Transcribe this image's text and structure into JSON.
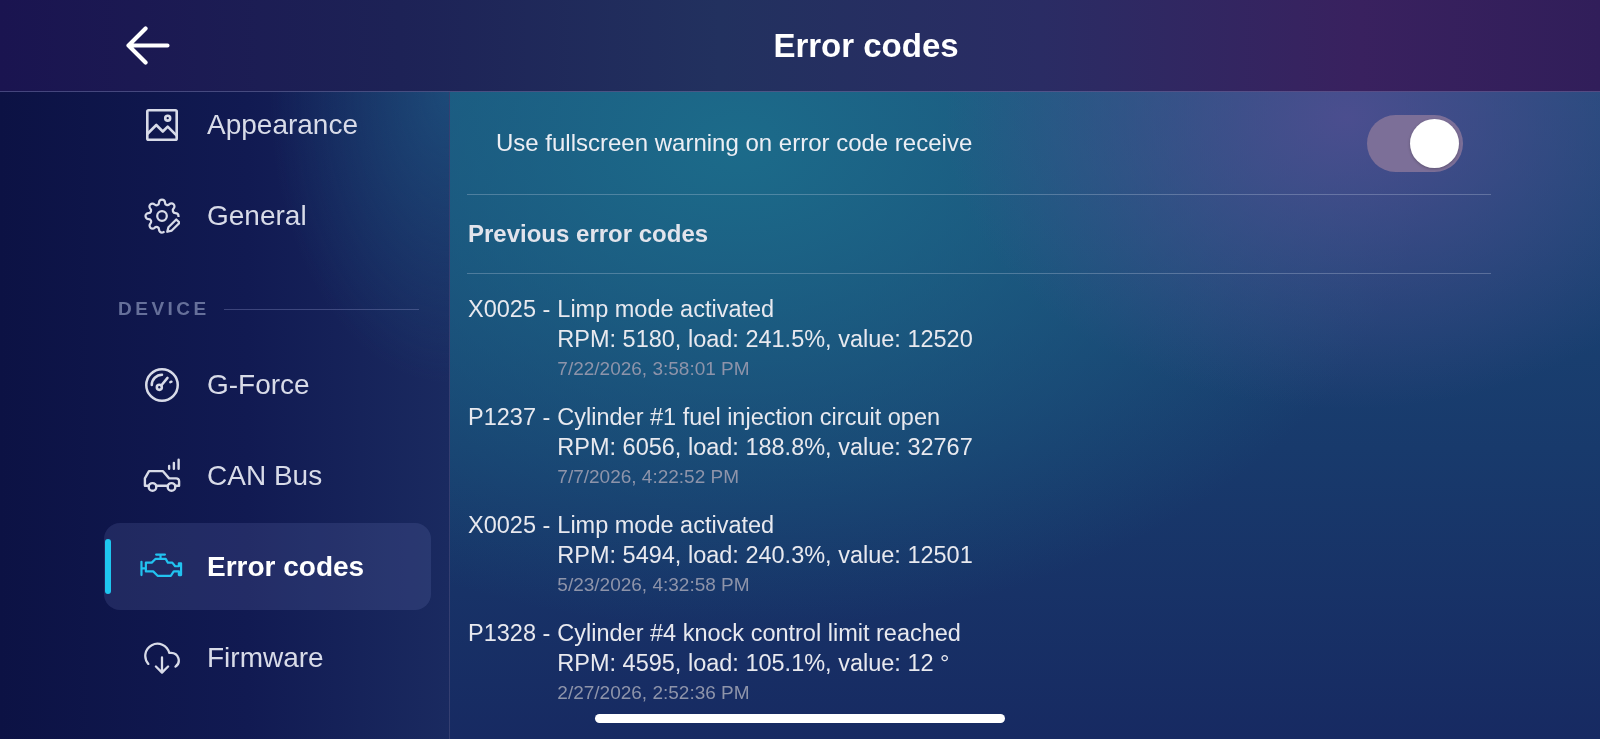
{
  "header": {
    "title": "Error codes"
  },
  "sidebar": {
    "items": [
      {
        "kind": "item",
        "label": "Appearance",
        "selected": false
      },
      {
        "kind": "item",
        "label": "General",
        "selected": false
      },
      {
        "kind": "section",
        "label": "DEVICE"
      },
      {
        "kind": "item",
        "label": "G-Force",
        "selected": false
      },
      {
        "kind": "item",
        "label": "CAN Bus",
        "selected": false
      },
      {
        "kind": "item",
        "label": "Error codes",
        "selected": true
      },
      {
        "kind": "item",
        "label": "Firmware",
        "selected": false
      }
    ]
  },
  "settings": [
    {
      "label": "Use fullscreen warning on error code receive",
      "on": true
    }
  ],
  "history": {
    "title": "Previous error codes",
    "entries": [
      {
        "code": "X0025 -",
        "description": "Limp mode activated",
        "details": "RPM: 5180, load: 241.5%, value: 12520",
        "timestamp": "7/22/2026, 3:58:01 PM"
      },
      {
        "code": "P1237 -",
        "description": "Cylinder #1 fuel injection circuit open",
        "details": "RPM: 6056, load: 188.8%, value: 32767",
        "timestamp": "7/7/2026, 4:22:52 PM"
      },
      {
        "code": "X0025 -",
        "description": "Limp mode activated",
        "details": "RPM: 5494, load: 240.3%, value: 12501",
        "timestamp": "5/23/2026, 4:32:58 PM"
      },
      {
        "code": "P1328 -",
        "description": "Cylinder #4 knock control limit reached",
        "details": "RPM: 4595, load: 105.1%, value: 12 °",
        "timestamp": "2/27/2026, 2:52:36 PM"
      }
    ]
  }
}
